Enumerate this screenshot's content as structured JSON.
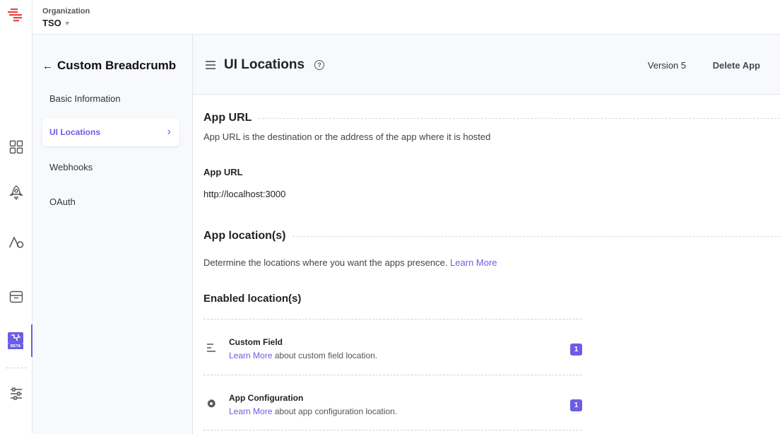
{
  "org": {
    "label": "Organization",
    "name": "TSO"
  },
  "rail": {
    "beta_badge": "BETA"
  },
  "subnav": {
    "title": "Custom Breadcrumb",
    "items": [
      {
        "label": "Basic Information"
      },
      {
        "label": "UI Locations"
      },
      {
        "label": "Webhooks"
      },
      {
        "label": "OAuth"
      }
    ]
  },
  "header": {
    "title": "UI Locations",
    "help_glyph": "?",
    "version": "Version 5",
    "delete_label": "Delete App"
  },
  "app_url": {
    "heading": "App URL",
    "description": "App URL is the destination or the address of the app where it is hosted",
    "field_label": "App URL",
    "field_value": "http://localhost:3000"
  },
  "app_locations": {
    "heading": "App location(s)",
    "description": "Determine the locations where you want the apps presence.",
    "learn_more": "Learn More",
    "enabled_heading": "Enabled location(s)",
    "items": [
      {
        "name": "Custom Field",
        "link": "Learn More",
        "desc": "about custom field location.",
        "count": "1",
        "icon": "list-lines-icon"
      },
      {
        "name": "App Configuration",
        "link": "Learn More",
        "desc": "about app configuration location.",
        "count": "1",
        "icon": "gear-icon"
      }
    ]
  },
  "colors": {
    "accent": "#6c5ce7",
    "brand_red": "#e8483f"
  }
}
